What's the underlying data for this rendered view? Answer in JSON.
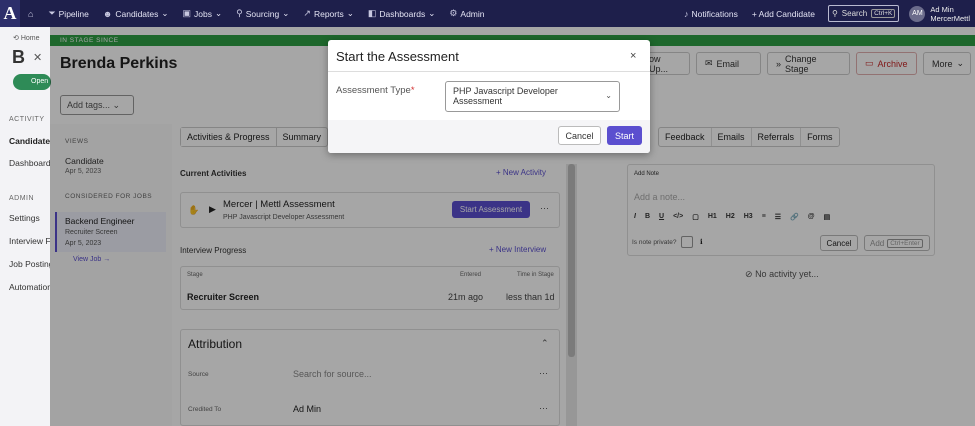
{
  "topnav": {
    "logo": "A",
    "items": [
      {
        "label": "Pipeline",
        "icon": "funnel-icon"
      },
      {
        "label": "Candidates",
        "icon": "users-icon"
      },
      {
        "label": "Jobs",
        "icon": "briefcase-icon"
      },
      {
        "label": "Sourcing",
        "icon": "sourcing-icon"
      },
      {
        "label": "Reports",
        "icon": "chart-icon"
      },
      {
        "label": "Dashboards",
        "icon": "dashboard-icon"
      },
      {
        "label": "Admin",
        "icon": "gear-icon"
      }
    ],
    "notifications": "Notifications",
    "add_candidate": "+ Add Candidate",
    "search_label": "Search",
    "search_kbd": "Ctrl+K",
    "avatar_initials": "AM",
    "user_name": "Ad Min",
    "user_org": "MercerMettl"
  },
  "left": {
    "breadcrumb_home": "Home",
    "big_initial": "B",
    "open_badge": "Open",
    "section_activity": "ACTIVITY",
    "items_activity": [
      "Candidate",
      "Dashboard"
    ],
    "section_admin": "ADMIN",
    "items_admin": [
      "Settings",
      "Interview F",
      "Job Posting",
      "Automation"
    ]
  },
  "profile": {
    "stage_bar": "IN STAGE SINCE",
    "name": "Brenda Perkins",
    "tags_placeholder": "Add tags...",
    "actions": {
      "follow_up": "ow Up...",
      "email": "Email",
      "change_stage": "Change Stage",
      "archive": "Archive",
      "more": "More"
    },
    "views_head": "VIEWS",
    "view_item": "Candidate",
    "view_date": "Apr 5, 2023",
    "jobs_head": "CONSIDERED FOR JOBS",
    "job_title": "Backend Engineer",
    "job_stage": "Recruiter Screen",
    "job_date": "Apr 5, 2023",
    "view_job": "View Job →",
    "tabs": [
      "Activities & Progress",
      "Summary"
    ],
    "tabs_right": [
      "Feedback",
      "Emails",
      "Referrals",
      "Forms"
    ],
    "current_activities": "Current Activities",
    "new_activity": "+ New Activity",
    "activity_title": "Mercer | Mettl Assessment",
    "activity_sub": "PHP Javascript Developer Assessment",
    "start_assessment": "Start Assessment",
    "interview_progress": "Interview Progress",
    "new_interview": "+ New Interview",
    "col_stage": "Stage",
    "col_entered": "Entered",
    "col_time": "Time in Stage",
    "stage_name": "Recruiter Screen",
    "stage_entered": "21m ago",
    "stage_time": "less than 1d",
    "attribution": "Attribution",
    "source_label": "Source",
    "source_placeholder": "Search for source...",
    "credited_label": "Credited To",
    "credited_value": "Ad Min"
  },
  "notes": {
    "title": "Add Note",
    "placeholder": "Add a note...",
    "private_label": "Is note private?",
    "cancel": "Cancel",
    "add": "Add",
    "add_kbd": "Ctrl+Enter",
    "no_activity": "No activity yet..."
  },
  "modal": {
    "title": "Start the Assessment",
    "close": "×",
    "label": "Assessment Type",
    "required_mark": "*",
    "select_value": "PHP Javascript Developer Assessment",
    "cancel": "Cancel",
    "start": "Start"
  }
}
